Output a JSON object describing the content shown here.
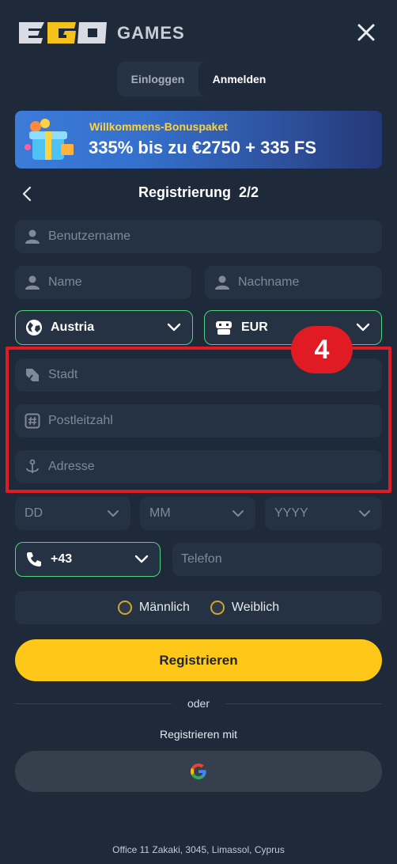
{
  "header": {
    "logo_text": "GAMES",
    "close_icon": "close-icon"
  },
  "tabs": [
    {
      "label": "Einloggen",
      "active": false
    },
    {
      "label": "Anmelden",
      "active": true
    }
  ],
  "banner": {
    "subtitle": "Willkommens-Bonuspaket",
    "headline": "335% bis zu €2750 + 335 FS"
  },
  "step": {
    "title": "Registrierung  2/2"
  },
  "form": {
    "username_placeholder": "Benutzername",
    "name_placeholder": "Name",
    "lastname_placeholder": "Nachname",
    "country_value": "Austria",
    "currency_value": "EUR",
    "city_placeholder": "Stadt",
    "zip_placeholder": "Postleitzahl",
    "address_placeholder": "Adresse",
    "day_placeholder": "DD",
    "month_placeholder": "MM",
    "year_placeholder": "YYYY",
    "phone_code": "+43",
    "phone_placeholder": "Telefon",
    "gender_male": "Männlich",
    "gender_female": "Weiblich"
  },
  "annotation": {
    "badge_number": "4",
    "color": "#e01b24"
  },
  "actions": {
    "register_label": "Registrieren",
    "or_label": "oder",
    "register_with_label": "Registrieren mit"
  },
  "footer": {
    "address": "Office 11 Zakaki, 3045, Limassol, Cyprus"
  },
  "colors": {
    "background": "#1e2a3a",
    "field": "#253243",
    "accent_green": "#4fd27b",
    "primary_yellow": "#ffc718"
  }
}
